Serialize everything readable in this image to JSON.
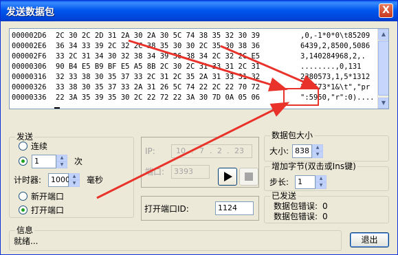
{
  "window": {
    "title": "发送数据包",
    "close_label": "X"
  },
  "hex_view": {
    "rows": [
      {
        "addr": "000002D6",
        "bytes": "2C 30 2C 2D 31 2A 30 2A 30 5C 74 38 35 32 30 39",
        "ascii": ",0,-1*0*0\\t85209"
      },
      {
        "addr": "000002E6",
        "bytes": "36 34 33 39 2C 32 2C 38 35 30 30 2C 35 30 38 36",
        "ascii": "6439,2,8500,5086"
      },
      {
        "addr": "000002F6",
        "bytes": "33 2C 31 34 30 32 38 34 39 36 38 34 2C 32 2C E5",
        "ascii": "3,140284968,2,."
      },
      {
        "addr": "00000306",
        "bytes": "90 B4 E5 B9 BF E5 A5 8B 2C 30 2C 31 33 31 2C 31",
        "ascii": "........,0,131"
      },
      {
        "addr": "00000316",
        "bytes": "32 33 38 30 35 37 33 2C 31 2C 35 2A 31 33 31 32",
        "ascii": "2380573,1,5*1312"
      },
      {
        "addr": "00000326",
        "bytes": "33 38 30 35 37 33 2A 31 26 5C 74 22 2C 22 70 72",
        "ascii": "380573*1&\\t\",\"pr"
      },
      {
        "addr": "00000336",
        "bytes": "22 3A 35 39 35 30 2C 22 72 22 3A 30 7D 0A 05 06",
        "ascii": "\":5950,\"r\":0)...."
      }
    ]
  },
  "send_group": {
    "title": "发送",
    "continuous_label": "连续",
    "count_value": "1",
    "count_unit": "次",
    "timer_label": "计时器:",
    "timer_value": "1000",
    "timer_unit": "毫秒",
    "new_port_label": "新开端口",
    "open_port_label": "打开端口",
    "mode_selected": "count",
    "port_selected": "open"
  },
  "connection": {
    "ip_label": "IP:",
    "ip": [
      "10",
      "7",
      "2",
      "23"
    ],
    "port_label": "端口:",
    "port_value": "3393",
    "open_port_id_label": "打开端口ID:",
    "open_port_id_value": "1124"
  },
  "packet_size_group": {
    "title": "数据包大小",
    "size_label": "大小:",
    "size_value": "838"
  },
  "add_byte_group": {
    "title": "增加字节(双击或Ins键)",
    "step_label": "步长:",
    "step_value": "1"
  },
  "sent_group": {
    "title": "已发送",
    "errors1_label": "数据包错误:",
    "errors1_value": "0",
    "errors2_label": "数据包错误:",
    "errors2_value": "0"
  },
  "info_group": {
    "title": "信息",
    "status": "就绪..."
  },
  "buttons": {
    "exit_label": "退出"
  },
  "colors": {
    "annotation": "#e8322a",
    "title_bar": "#0058ee",
    "selection_box": "#e8322a"
  },
  "icons": {
    "play": "play-icon",
    "stop": "stop-icon",
    "close": "close-icon"
  }
}
